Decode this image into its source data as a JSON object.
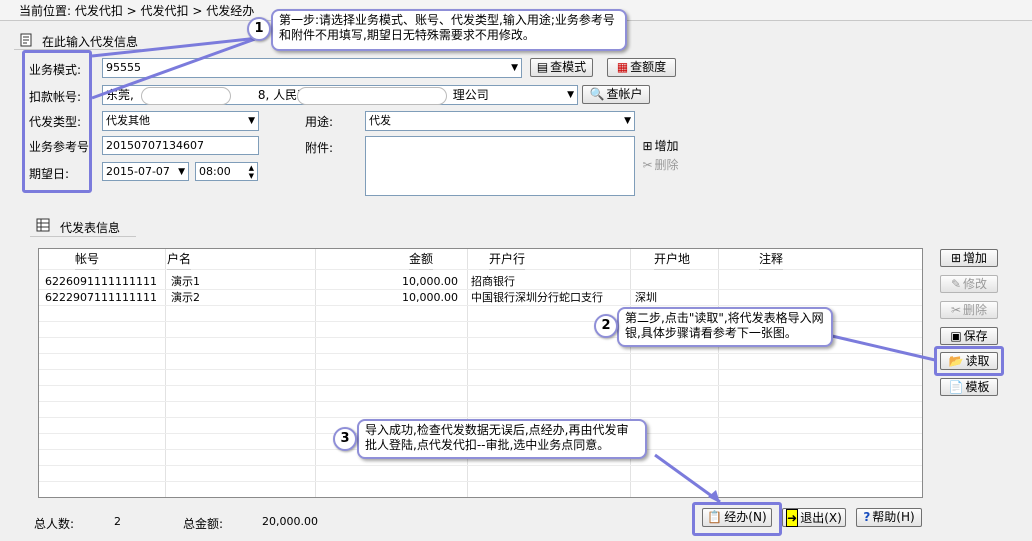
{
  "breadcrumb": "当前位置: 代发代扣 > 代发代扣 > 代发经办",
  "form": {
    "section_title": "在此输入代发信息",
    "business_mode_label": "业务模式:",
    "business_mode_value": "95555",
    "view_mode_button": "查模式",
    "view_quota_button": "查额度",
    "account_label": "扣款帐号:",
    "account_value": "东莞, [redacted], 人民币, [redacted]理公司",
    "account_prefix": "东莞,",
    "account_mid": "8, 人民币,",
    "account_mid2": "中",
    "account_suffix": "理公司",
    "view_account_button": "查帐户",
    "type_label": "代发类型:",
    "type_value": "代发其他",
    "purpose_label": "用途:",
    "purpose_value": "代发",
    "ref_label": "业务参考号:",
    "ref_value": "20150707134607",
    "attach_label": "附件:",
    "attach_add_button": "增加",
    "attach_delete_button": "删除",
    "date_label": "期望日:",
    "date_value": "2015-07-07",
    "time_value": "08:00"
  },
  "table": {
    "section_title": "代发表信息",
    "columns": [
      "帐号",
      "户名",
      "金额",
      "开户行",
      "开户地",
      "注释"
    ],
    "rows": [
      {
        "account": "6226091111111111",
        "name": "演示1",
        "amount": "10,000.00",
        "bank": "招商银行",
        "location": "",
        "note": ""
      },
      {
        "account": "6222907111111111",
        "name": "演示2",
        "amount": "10,000.00",
        "bank": "中国银行深圳分行蛇口支行",
        "location": "深圳",
        "note": ""
      }
    ]
  },
  "side_buttons": {
    "add": "增加",
    "edit": "修改",
    "delete": "删除",
    "save": "保存",
    "read": "读取",
    "template": "模板"
  },
  "footer": {
    "total_people_label": "总人数:",
    "total_people_value": "2",
    "total_amount_label": "总金额:",
    "total_amount_value": "20,000.00",
    "process_button": "经办(N)",
    "exit_button": "退出(X)",
    "help_button": "帮助(H)"
  },
  "callouts": [
    {
      "num": "1",
      "text": "第一步:请选择业务模式、账号、代发类型,输入用途;业务参考号和附件不用填写,期望日无特殊需要求不用修改。"
    },
    {
      "num": "2",
      "text": "第二步,点击\"读取\",将代发表格导入网银,具体步骤请看参考下一张图。"
    },
    {
      "num": "3",
      "text": "导入成功,检查代发数据无误后,点经办,再由代发审批人登陆,点代发代扣--审批,选中业务点同意。"
    }
  ],
  "colors": {
    "callout_border": "#8f8fd8",
    "highlight": "#7b7bdc",
    "background": "#f0f0f0"
  }
}
